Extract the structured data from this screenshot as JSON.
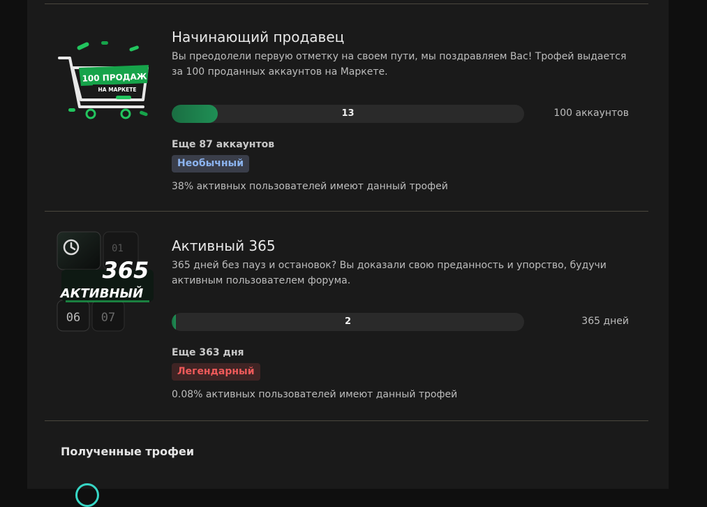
{
  "trophies": [
    {
      "title": "Начинающий продавец",
      "description": "Вы преодолели первую отметку на своем пути, мы поздравляем Вас! Трофей выдается за 100 проданных аккаунтов на Маркете.",
      "image_text": {
        "line1": "100 ПРОДАЖ",
        "line2": "НА МАРКЕТЕ"
      },
      "progress": {
        "current": "13",
        "fraction": 0.13,
        "target_label": "100 аккаунтов"
      },
      "remaining": "Еще 87 аккаунтов",
      "rarity": "Необычный",
      "stats": "38% активных пользователей имеют данный трофей"
    },
    {
      "title": "Активный 365",
      "description": "365 дней без пауз и остановок? Вы доказали свою преданность и упорство, будучи активным пользователем форума.",
      "image_text": {
        "big": "365",
        "word": "АКТИВНЫЙ",
        "digits_top": "01",
        "digits_bottom_a": "06",
        "digits_bottom_b": "07"
      },
      "progress": {
        "current": "2",
        "fraction": 0.0055,
        "target_label": "365 дней"
      },
      "remaining": "Еще 363 дня",
      "rarity": "Легендарный",
      "stats": "0.08% активных пользователей имеют данный трофей"
    }
  ],
  "section": {
    "received_title": "Полученные трофеи"
  },
  "colors": {
    "page_bg": "#0f0f0f",
    "panel_bg": "#1a1a1a",
    "progress_fill": "#1f8f55",
    "uncommon_text": "#8cb4f0",
    "legendary_text": "#ef5a5a",
    "accent_green": "#22c55e"
  }
}
